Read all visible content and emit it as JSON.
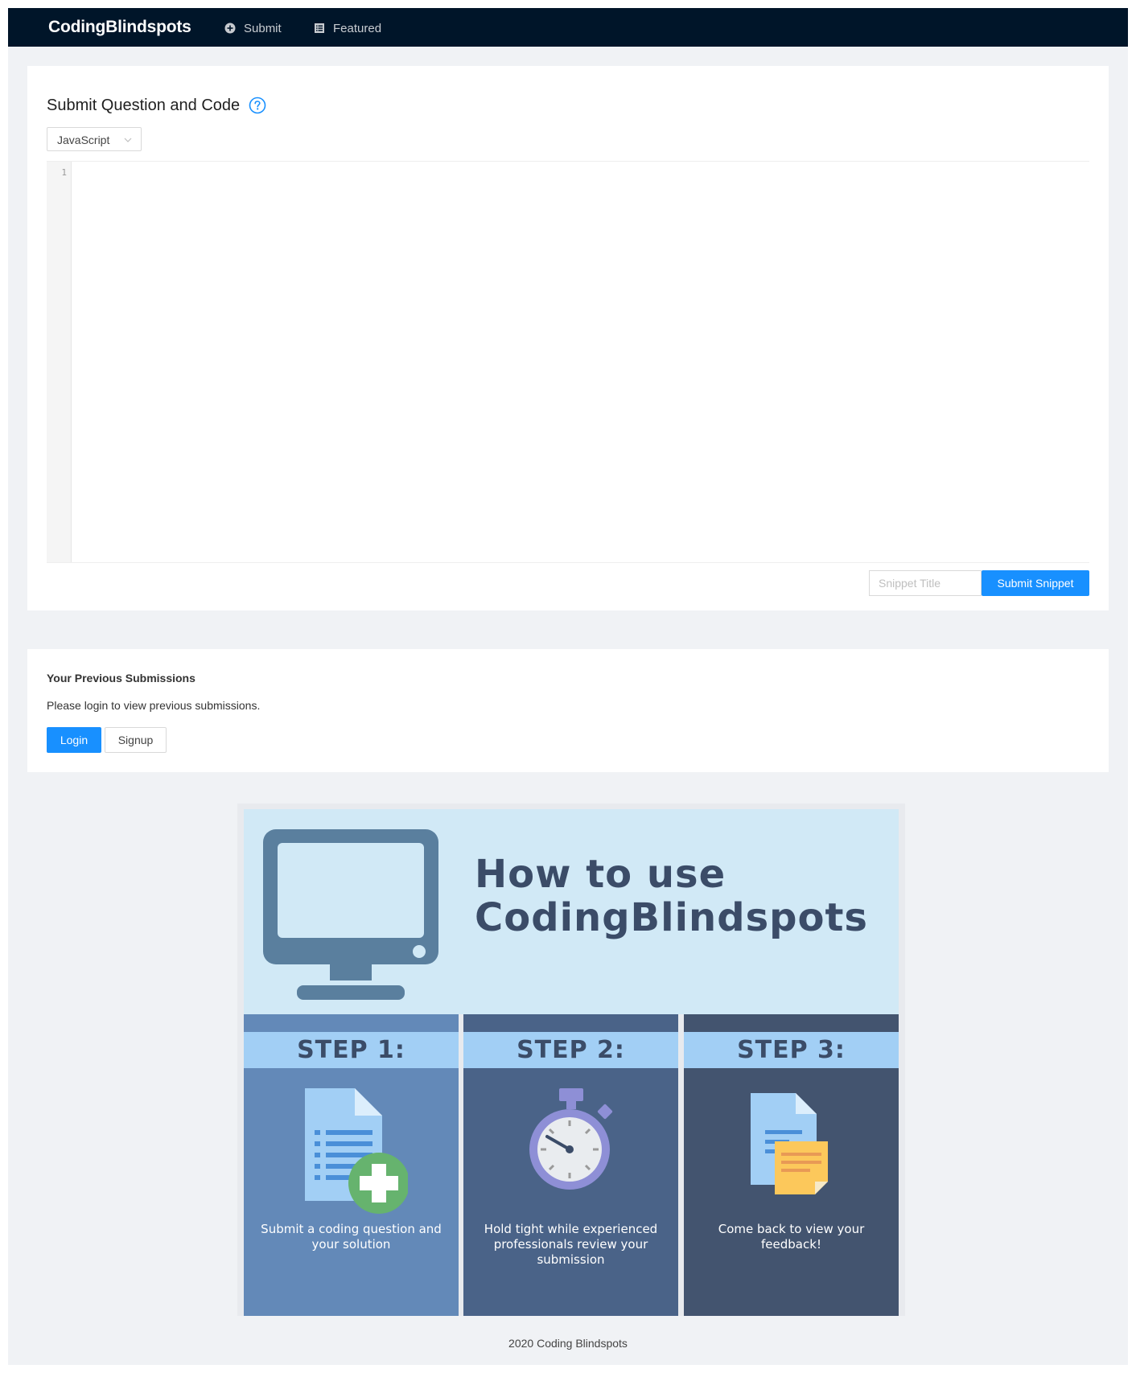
{
  "header": {
    "brand": "CodingBlindspots",
    "nav": [
      {
        "label": "Submit",
        "icon": "plus-circle-icon"
      },
      {
        "label": "Featured",
        "icon": "list-icon"
      }
    ]
  },
  "submit_card": {
    "title": "Submit Question and Code",
    "help_icon": "question-circle-icon",
    "language": {
      "selected": "JavaScript"
    },
    "editor": {
      "line_numbers": [
        "1"
      ],
      "code": ""
    },
    "snippet_title": {
      "placeholder": "Snippet Title",
      "value": ""
    },
    "submit_label": "Submit Snippet"
  },
  "previous_card": {
    "title": "Your Previous Submissions",
    "message": "Please login to view previous submissions.",
    "login_label": "Login",
    "signup_label": "Signup"
  },
  "infographic": {
    "heading_line1": "How to use",
    "heading_line2": "CodingBlindspots",
    "steps": [
      {
        "label": "STEP 1:",
        "text": "Submit a coding question and your solution",
        "icon": "document-plus-icon"
      },
      {
        "label": "STEP 2:",
        "text": "Hold tight while experienced professionals review your submission",
        "icon": "stopwatch-icon"
      },
      {
        "label": "STEP 3:",
        "text": "Come back to view your feedback!",
        "icon": "document-note-icon"
      }
    ]
  },
  "footer": {
    "text": "2020 Coding Blindspots"
  },
  "colors": {
    "header_bg": "#001529",
    "primary": "#1890ff",
    "page_bg": "#f0f2f5",
    "step1": "#6389b8",
    "step2": "#4a6388",
    "step3": "#43546f",
    "band": "#a2cff5"
  }
}
